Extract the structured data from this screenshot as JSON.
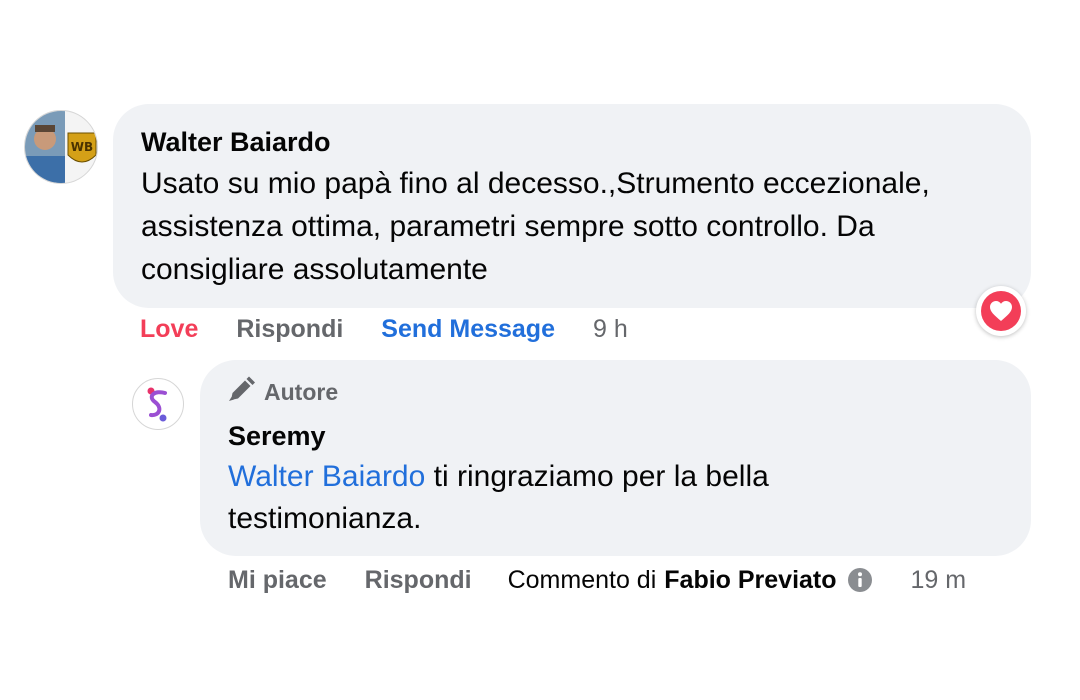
{
  "comment": {
    "author": "Walter Baiardo",
    "text": "Usato su mio papà fino al decesso.,Strumento eccezionale, assistenza ottima, parametri sempre sotto controllo. Da consigliare assolutamente",
    "reaction_icon": "heart-reaction-icon",
    "actions": {
      "love": "Love",
      "reply": "Rispondi",
      "send_message": "Send Message",
      "time": "9 h"
    }
  },
  "reply": {
    "badge": "Autore",
    "author": "Seremy",
    "mention": "Walter Baiardo",
    "text": " ti ringraziamo per la bella testimonianza.",
    "actions": {
      "like": "Mi piace",
      "reply": "Rispondi",
      "commented_by_prefix": "Commento di",
      "commented_by_name": "Fabio Previato",
      "time": "19 m"
    }
  },
  "colors": {
    "bubble": "#f0f2f5",
    "love": "#f33e58",
    "link": "#216fdb",
    "secondary_text": "#65676b"
  }
}
